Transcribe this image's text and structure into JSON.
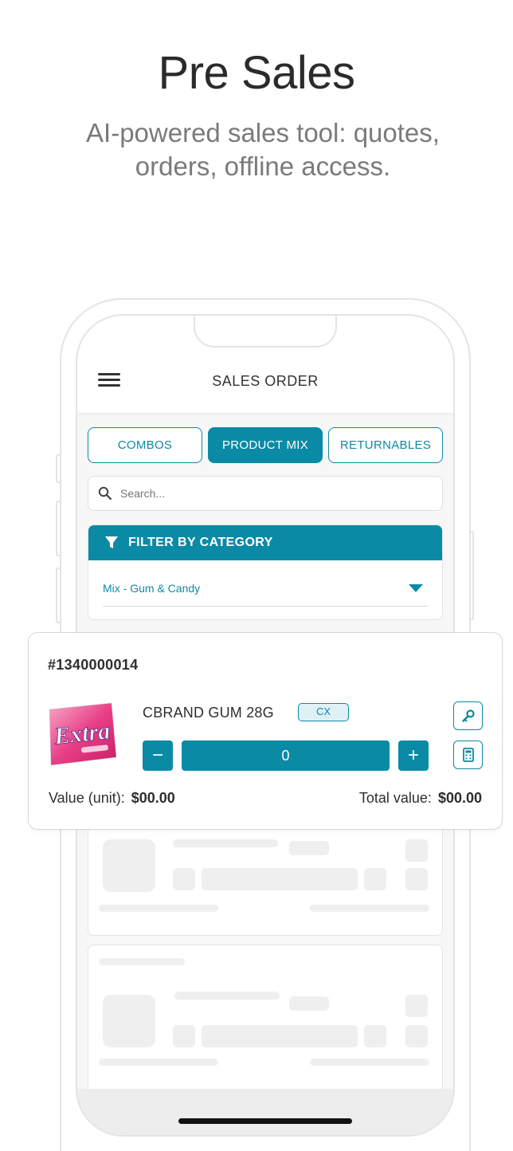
{
  "hero": {
    "title": "Pre Sales",
    "subtitle_line1": "AI-powered sales tool: quotes,",
    "subtitle_line2": "orders, offline access."
  },
  "app": {
    "screen_title": "SALES ORDER",
    "tabs": [
      {
        "label": "COMBOS",
        "active": false
      },
      {
        "label": "PRODUCT MIX",
        "active": true
      },
      {
        "label": "RETURNABLES",
        "active": false
      }
    ],
    "search": {
      "placeholder": "Search...",
      "value": ""
    },
    "filter": {
      "title": "FILTER BY CATEGORY",
      "selected": "Mix - Gum & Candy"
    },
    "accent_color": "#0b8aa6"
  },
  "product_card": {
    "order_id": "#1340000014",
    "product_name": "CBRAND GUM 28G",
    "badge": "CX",
    "brand_image_text": "Extra",
    "quantity": "0",
    "minus_label": "−",
    "plus_label": "+",
    "unit_value_label": "Value (unit):",
    "unit_value": "$00.00",
    "total_value_label": "Total value:",
    "total_value": "$00.00",
    "icons": [
      "key-icon",
      "calculator-icon",
      "search-icon",
      "filter-icon",
      "menu-icon"
    ]
  }
}
